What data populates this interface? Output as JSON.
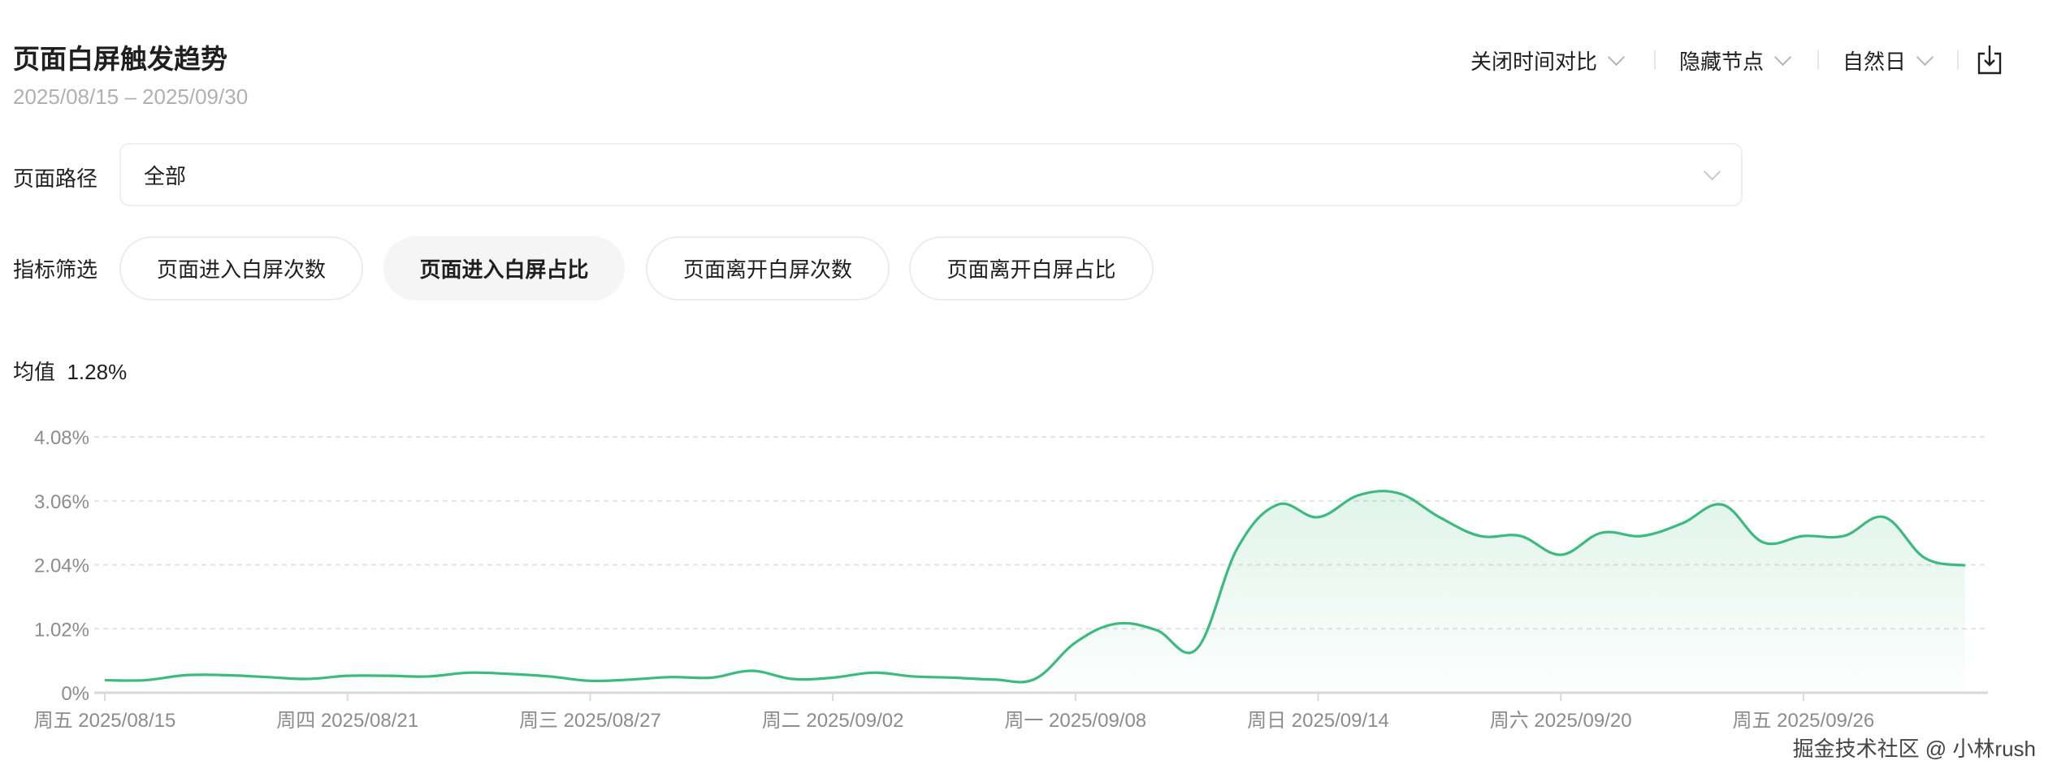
{
  "header": {
    "title": "页面白屏触发趋势",
    "date_range": "2025/08/15 – 2025/09/30",
    "controls": [
      {
        "label": "关闭时间对比",
        "icon": "chevron-down-icon"
      },
      {
        "label": "隐藏节点",
        "icon": "chevron-down-icon"
      },
      {
        "label": "自然日",
        "icon": "chevron-down-icon"
      }
    ],
    "download_icon": "download-icon"
  },
  "filters": {
    "path_label": "页面路径",
    "path_value": "全部",
    "metric_label": "指标筛选",
    "metrics": [
      {
        "label": "页面进入白屏次数",
        "active": false
      },
      {
        "label": "页面进入白屏占比",
        "active": true
      },
      {
        "label": "页面离开白屏次数",
        "active": false
      },
      {
        "label": "页面离开白屏占比",
        "active": false
      }
    ]
  },
  "summary": {
    "label": "均值",
    "value": "1.28%"
  },
  "watermark": "掘金技术社区 @ 小林rush",
  "chart_data": {
    "type": "area",
    "title": "",
    "xlabel": "",
    "ylabel": "",
    "ylim": [
      0,
      4.08
    ],
    "yticks": [
      "0%",
      "1.02%",
      "2.04%",
      "3.06%",
      "4.08%"
    ],
    "grid": true,
    "line_color": "#3dba7e",
    "xtick_labels": [
      "周五 2025/08/15",
      "周四 2025/08/21",
      "周三 2025/08/27",
      "周二 2025/09/02",
      "周一 2025/09/08",
      "周日 2025/09/14",
      "周六 2025/09/20",
      "周五 2025/09/26"
    ],
    "x": [
      "2025/08/15",
      "2025/08/16",
      "2025/08/17",
      "2025/08/18",
      "2025/08/19",
      "2025/08/20",
      "2025/08/21",
      "2025/08/22",
      "2025/08/23",
      "2025/08/24",
      "2025/08/25",
      "2025/08/26",
      "2025/08/27",
      "2025/08/28",
      "2025/08/29",
      "2025/08/30",
      "2025/08/31",
      "2025/09/01",
      "2025/09/02",
      "2025/09/03",
      "2025/09/04",
      "2025/09/05",
      "2025/09/06",
      "2025/09/07",
      "2025/09/08",
      "2025/09/09",
      "2025/09/10",
      "2025/09/11",
      "2025/09/12",
      "2025/09/13",
      "2025/09/14",
      "2025/09/15",
      "2025/09/16",
      "2025/09/17",
      "2025/09/18",
      "2025/09/19",
      "2025/09/20",
      "2025/09/21",
      "2025/09/22",
      "2025/09/23",
      "2025/09/24",
      "2025/09/25",
      "2025/09/26",
      "2025/09/27",
      "2025/09/28",
      "2025/09/29",
      "2025/09/30"
    ],
    "values": [
      0.2,
      0.2,
      0.28,
      0.28,
      0.25,
      0.22,
      0.27,
      0.27,
      0.26,
      0.32,
      0.3,
      0.26,
      0.19,
      0.21,
      0.25,
      0.24,
      0.35,
      0.22,
      0.24,
      0.32,
      0.26,
      0.24,
      0.21,
      0.22,
      0.8,
      1.1,
      1.0,
      0.7,
      2.3,
      3.0,
      2.8,
      3.15,
      3.18,
      2.8,
      2.5,
      2.5,
      2.2,
      2.55,
      2.5,
      2.7,
      3.0,
      2.4,
      2.5,
      2.5,
      2.8,
      2.15,
      2.03
    ]
  }
}
